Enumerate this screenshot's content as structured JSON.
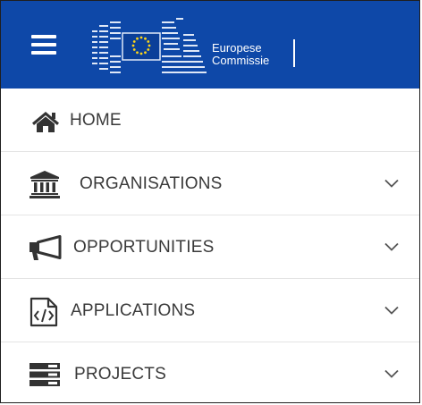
{
  "header": {
    "logo_line1": "Europese",
    "logo_line2": "Commissie",
    "background_color": "#0e48a8"
  },
  "menu": {
    "items": [
      {
        "label": "HOME",
        "icon": "home-icon",
        "expandable": false
      },
      {
        "label": "ORGANISATIONS",
        "icon": "institution-icon",
        "expandable": true
      },
      {
        "label": "OPPORTUNITIES",
        "icon": "megaphone-icon",
        "expandable": true
      },
      {
        "label": "APPLICATIONS",
        "icon": "code-file-icon",
        "expandable": true
      },
      {
        "label": "PROJECTS",
        "icon": "server-icon",
        "expandable": true
      }
    ]
  }
}
